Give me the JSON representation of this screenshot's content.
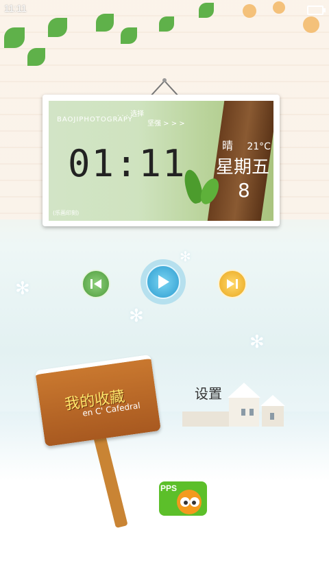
{
  "status_bar": {
    "time": "11:11",
    "battery_icon": "battery-icon"
  },
  "widget": {
    "brand": "BAOJIPHOTOGRAPY",
    "slogan_line1": ". . . 选择",
    "slogan_line2": "坚强 > > >",
    "time": "01:11",
    "weather": "晴",
    "temperature": "21°C",
    "weekday": "星期五",
    "day": "8",
    "credit": "(乐画印刻)"
  },
  "media_controls": {
    "prev_icon": "previous-icon",
    "play_icon": "play-icon",
    "next_icon": "next-icon"
  },
  "shortcuts": {
    "favorites_label": "我的收藏",
    "favorites_sub": "en C' Cafedral",
    "settings_label": "设置",
    "pps_label": "PPS"
  },
  "colors": {
    "prev": "#5aa845",
    "play": "#2c9cd0",
    "next": "#f0b22a",
    "sign": "#b8662a"
  }
}
